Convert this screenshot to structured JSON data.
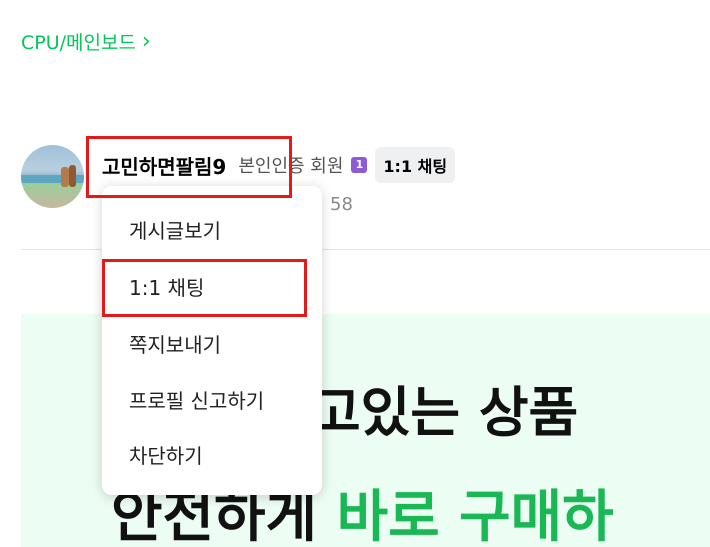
{
  "category": {
    "label": "CPU/메인보드",
    "chevron": "chevron-right-icon"
  },
  "author": {
    "nickname": "고민하면팔림9",
    "verification": "본인인증 회원",
    "level_badge": "1",
    "chat_button": "1:1 채팅",
    "meta_count": "58"
  },
  "banner": {
    "line1": "고있는 상품",
    "line2_plain": "안전하게",
    "line2_highlight": "바로 구매하",
    "highlight_color": "#19b855"
  },
  "context_menu": {
    "items": [
      "게시글보기",
      "1:1 채팅",
      "쪽지보내기",
      "프로필 신고하기",
      "차단하기"
    ]
  },
  "colors": {
    "accent": "#03c75a",
    "annotation": "#e21a1a"
  }
}
